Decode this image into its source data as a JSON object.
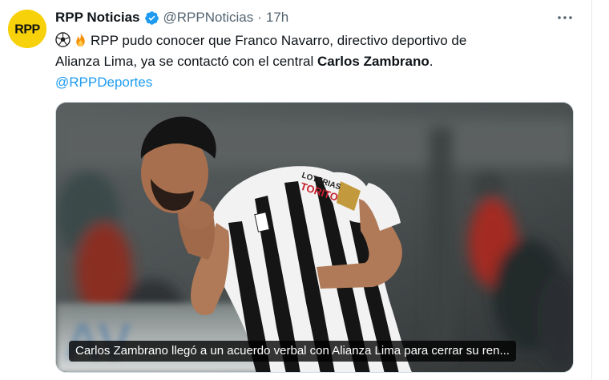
{
  "author": {
    "name": "RPP Noticias",
    "handle": "@RPPNoticias",
    "separator": "·",
    "time": "17h",
    "avatar_text": "RPP",
    "avatar_color": "#f7d10a",
    "verified_color": "#1d9bf0"
  },
  "more_icon": "more-horizontal-icon",
  "tweet": {
    "emojis": [
      "soccer-ball-emoji",
      "fire-emoji"
    ],
    "line1": "RPP pudo conocer que Franco Navarro, directivo deportivo de",
    "line2_start": "Alianza Lima, ya se contactó con el central ",
    "line2_bold": "Carlos Zambrano",
    "line2_end": ".",
    "mention": "@RPPDeportes",
    "mention_color": "#1d9bf0"
  },
  "media": {
    "caption": "Carlos Zambrano llegó a un acuerdo verbal con Alianza Lima para cerrar su ren...",
    "jersey_sponsor_line1": "LOTERIAS",
    "jersey_sponsor_line2": "TORITO"
  }
}
